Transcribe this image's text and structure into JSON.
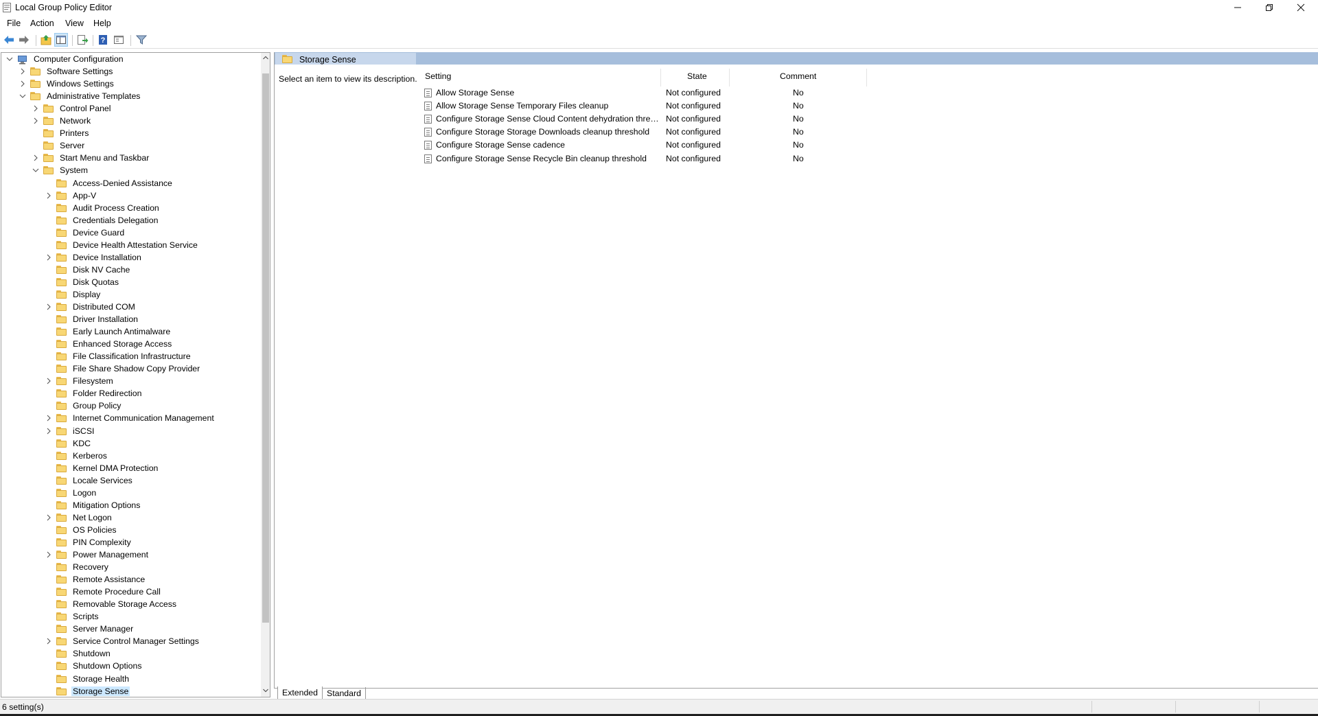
{
  "window": {
    "title": "Local Group Policy Editor"
  },
  "menu": [
    "File",
    "Action",
    "View",
    "Help"
  ],
  "toolbar": {
    "buttons": [
      "back-icon",
      "forward-icon",
      "up-folder-icon",
      "show-hide-tree-icon",
      "export-list-icon",
      "help-icon",
      "properties-icon",
      "filter-icon"
    ]
  },
  "tree": {
    "items": [
      {
        "label": "Computer Configuration",
        "level": 0,
        "chevron": "down"
      },
      {
        "label": "Software Settings",
        "level": 1,
        "chevron": "right"
      },
      {
        "label": "Windows Settings",
        "level": 1,
        "chevron": "right"
      },
      {
        "label": "Administrative Templates",
        "level": 1,
        "chevron": "down"
      },
      {
        "label": "Control Panel",
        "level": 2,
        "chevron": "right"
      },
      {
        "label": "Network",
        "level": 2,
        "chevron": "right"
      },
      {
        "label": "Printers",
        "level": 2,
        "chevron": ""
      },
      {
        "label": "Server",
        "level": 2,
        "chevron": ""
      },
      {
        "label": "Start Menu and Taskbar",
        "level": 2,
        "chevron": "right"
      },
      {
        "label": "System",
        "level": 2,
        "chevron": "down"
      },
      {
        "label": "Access-Denied Assistance",
        "level": 3,
        "chevron": ""
      },
      {
        "label": "App-V",
        "level": 3,
        "chevron": "right"
      },
      {
        "label": "Audit Process Creation",
        "level": 3,
        "chevron": ""
      },
      {
        "label": "Credentials Delegation",
        "level": 3,
        "chevron": ""
      },
      {
        "label": "Device Guard",
        "level": 3,
        "chevron": ""
      },
      {
        "label": "Device Health Attestation Service",
        "level": 3,
        "chevron": ""
      },
      {
        "label": "Device Installation",
        "level": 3,
        "chevron": "right"
      },
      {
        "label": "Disk NV Cache",
        "level": 3,
        "chevron": ""
      },
      {
        "label": "Disk Quotas",
        "level": 3,
        "chevron": ""
      },
      {
        "label": "Display",
        "level": 3,
        "chevron": ""
      },
      {
        "label": "Distributed COM",
        "level": 3,
        "chevron": "right"
      },
      {
        "label": "Driver Installation",
        "level": 3,
        "chevron": ""
      },
      {
        "label": "Early Launch Antimalware",
        "level": 3,
        "chevron": ""
      },
      {
        "label": "Enhanced Storage Access",
        "level": 3,
        "chevron": ""
      },
      {
        "label": "File Classification Infrastructure",
        "level": 3,
        "chevron": ""
      },
      {
        "label": "File Share Shadow Copy Provider",
        "level": 3,
        "chevron": ""
      },
      {
        "label": "Filesystem",
        "level": 3,
        "chevron": "right"
      },
      {
        "label": "Folder Redirection",
        "level": 3,
        "chevron": ""
      },
      {
        "label": "Group Policy",
        "level": 3,
        "chevron": ""
      },
      {
        "label": "Internet Communication Management",
        "level": 3,
        "chevron": "right"
      },
      {
        "label": "iSCSI",
        "level": 3,
        "chevron": "right"
      },
      {
        "label": "KDC",
        "level": 3,
        "chevron": ""
      },
      {
        "label": "Kerberos",
        "level": 3,
        "chevron": ""
      },
      {
        "label": "Kernel DMA Protection",
        "level": 3,
        "chevron": ""
      },
      {
        "label": "Locale Services",
        "level": 3,
        "chevron": ""
      },
      {
        "label": "Logon",
        "level": 3,
        "chevron": ""
      },
      {
        "label": "Mitigation Options",
        "level": 3,
        "chevron": ""
      },
      {
        "label": "Net Logon",
        "level": 3,
        "chevron": "right"
      },
      {
        "label": "OS Policies",
        "level": 3,
        "chevron": ""
      },
      {
        "label": "PIN Complexity",
        "level": 3,
        "chevron": ""
      },
      {
        "label": "Power Management",
        "level": 3,
        "chevron": "right"
      },
      {
        "label": "Recovery",
        "level": 3,
        "chevron": ""
      },
      {
        "label": "Remote Assistance",
        "level": 3,
        "chevron": ""
      },
      {
        "label": "Remote Procedure Call",
        "level": 3,
        "chevron": ""
      },
      {
        "label": "Removable Storage Access",
        "level": 3,
        "chevron": ""
      },
      {
        "label": "Scripts",
        "level": 3,
        "chevron": ""
      },
      {
        "label": "Server Manager",
        "level": 3,
        "chevron": ""
      },
      {
        "label": "Service Control Manager Settings",
        "level": 3,
        "chevron": "right"
      },
      {
        "label": "Shutdown",
        "level": 3,
        "chevron": ""
      },
      {
        "label": "Shutdown Options",
        "level": 3,
        "chevron": ""
      },
      {
        "label": "Storage Health",
        "level": 3,
        "chevron": ""
      },
      {
        "label": "Storage Sense",
        "level": 3,
        "chevron": "",
        "selected": true
      }
    ]
  },
  "details": {
    "header_title": "Storage Sense",
    "description": "Select an item to view its description.",
    "columns": [
      "Setting",
      "State",
      "Comment"
    ],
    "rows": [
      {
        "setting": "Allow Storage Sense",
        "state": "Not configured",
        "comment": "No"
      },
      {
        "setting": "Allow Storage Sense Temporary Files cleanup",
        "state": "Not configured",
        "comment": "No"
      },
      {
        "setting": "Configure Storage Sense Cloud Content dehydration thresh...",
        "state": "Not configured",
        "comment": "No"
      },
      {
        "setting": "Configure Storage Storage Downloads cleanup threshold",
        "state": "Not configured",
        "comment": "No"
      },
      {
        "setting": "Configure Storage Sense cadence",
        "state": "Not configured",
        "comment": "No"
      },
      {
        "setting": "Configure Storage Sense Recycle Bin cleanup threshold",
        "state": "Not configured",
        "comment": "No"
      }
    ]
  },
  "tabs": [
    "Extended",
    "Standard"
  ],
  "status": {
    "text": "6 setting(s)"
  }
}
